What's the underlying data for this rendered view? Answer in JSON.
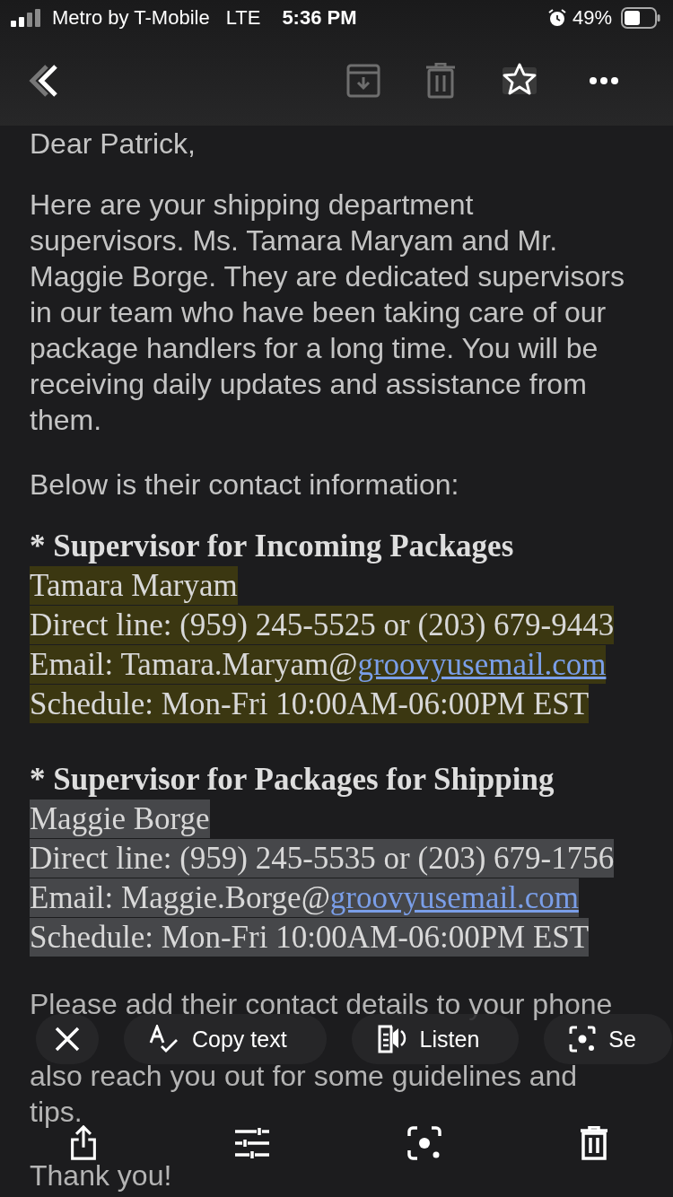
{
  "status_bar": {
    "carrier": "Metro by T-Mobile",
    "network": "LTE",
    "time": "5:36 PM",
    "battery": "49%"
  },
  "email": {
    "greeting": "Dear Patrick,",
    "intro": "Here are your shipping department supervisors. Ms. Tamara Maryam and Mr. Maggie Borge. They are dedicated supervisors in our team who have been taking care of our package handlers for a long time. You will be receiving daily updates and assistance from them.",
    "lead": "Below is their contact information:",
    "contacts": [
      {
        "heading": "* Supervisor for Incoming Packages",
        "color": "#3b3711",
        "lines": [
          {
            "kind": "text",
            "text": "Tamara Maryam"
          },
          {
            "kind": "text",
            "text": "Direct line: (959) 245-5525 or (203) 679-9443"
          },
          {
            "kind": "link",
            "text": "Email: Tamara.Maryam@",
            "link": "groovyusemail.com"
          },
          {
            "kind": "text",
            "text": "Schedule: Mon-Fri 10:00AM-06:00PM EST"
          }
        ]
      },
      {
        "heading": "* Supervisor for Packages for Shipping",
        "color": "#46474a",
        "lines": [
          {
            "kind": "text",
            "text": "Maggie Borge"
          },
          {
            "kind": "text",
            "text": "Direct line: (959) 245-5535 or (203) 679-1756"
          },
          {
            "kind": "link",
            "text": "Email: Maggie.Borge@",
            "link": "groovyusemail.com"
          },
          {
            "kind": "text",
            "text": "Schedule: Mon-Fri 10:00AM-06:00PM EST"
          }
        ]
      }
    ],
    "closing_lines": [
      "Please add their contact details to your phone",
      "also reach you out for some guidelines and",
      "tips."
    ],
    "signoff": "Thank you!"
  },
  "text_actions": [
    {
      "kind": "close"
    },
    {
      "kind": "copy",
      "label": "Copy text"
    },
    {
      "kind": "listen",
      "label": "Listen"
    },
    {
      "kind": "select",
      "label": "Se"
    }
  ],
  "bottom_toolbar": [
    {
      "kind": "share"
    },
    {
      "kind": "adjust"
    },
    {
      "kind": "lens"
    },
    {
      "kind": "delete"
    }
  ]
}
